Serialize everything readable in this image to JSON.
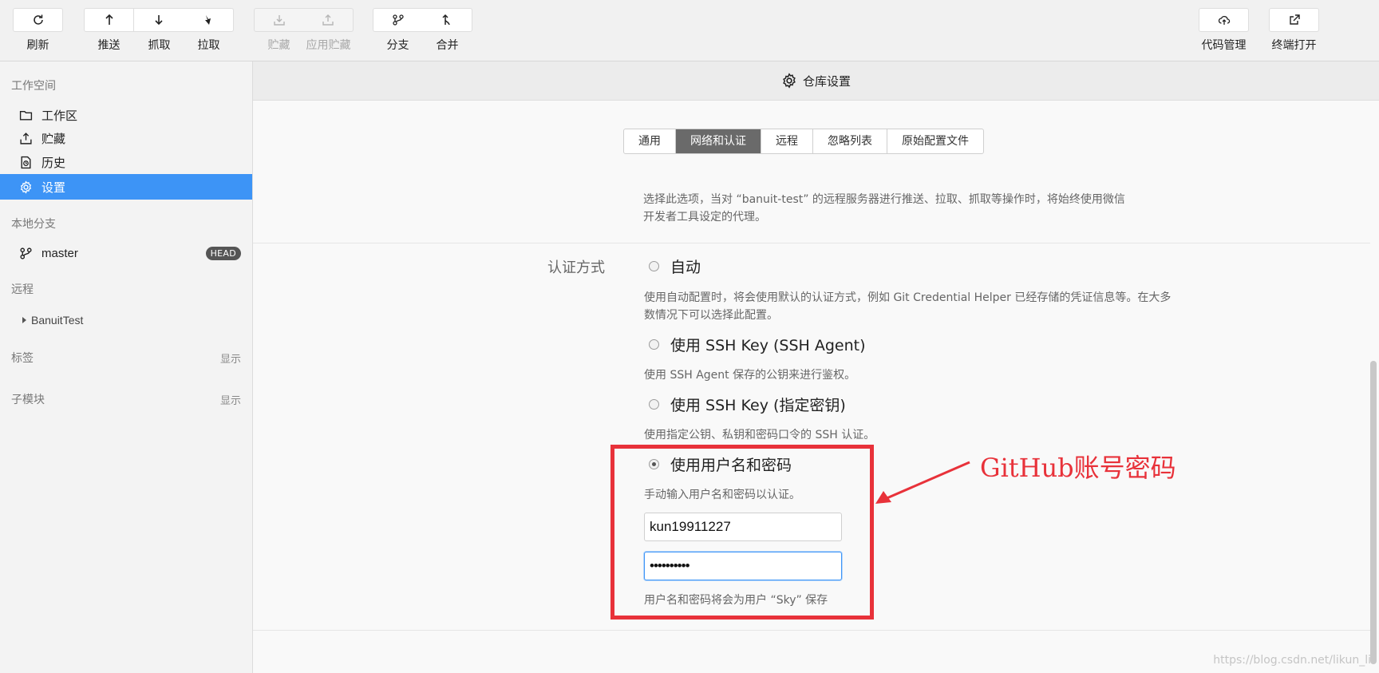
{
  "toolbar": {
    "refresh": "刷新",
    "push": "推送",
    "fetch": "抓取",
    "pull": "拉取",
    "stash": "贮藏",
    "apply_stash": "应用贮藏",
    "branch": "分支",
    "merge": "合并",
    "code_manage": "代码管理",
    "terminal_open": "终端打开"
  },
  "sidebar": {
    "workspace_title": "工作空间",
    "items": [
      "工作区",
      "贮藏",
      "历史",
      "设置"
    ],
    "local_branches_title": "本地分支",
    "branch_name": "master",
    "head_badge": "HEAD",
    "remote_title": "远程",
    "remote_name": "BanuitTest",
    "tags_title": "标签",
    "tags_show": "显示",
    "submodule_title": "子模块",
    "submodule_show": "显示"
  },
  "main": {
    "header_title": "仓库设置",
    "tabs": [
      "通用",
      "网络和认证",
      "远程",
      "忽略列表",
      "原始配置文件"
    ],
    "active_tab": "网络和认证",
    "proxy_desc_1": "选择此选项，当对 “banuit-test” 的远程服务器进行推送、拉取、抓取等操作时，将始终使用微信",
    "proxy_desc_2": "开发者工具设定的代理。",
    "auth_label": "认证方式",
    "options": [
      {
        "label": "自动",
        "desc1": "使用自动配置时，将会使用默认的认证方式，例如 Git Credential Helper 已经存储的凭证信息等。在大多",
        "desc2": "数情况下可以选择此配置。"
      },
      {
        "label": "使用 SSH Key (SSH Agent)",
        "desc1": "使用 SSH Agent 保存的公钥来进行鉴权。"
      },
      {
        "label": "使用 SSH Key (指定密钥)",
        "desc1": "使用指定公钥、私钥和密码口令的 SSH 认证。"
      },
      {
        "label": "使用用户名和密码",
        "desc1": "手动输入用户名和密码以认证。"
      }
    ],
    "username_value": "kun19911227",
    "password_value": "••••••••••",
    "save_note": "用户名和密码将会为用户 “Sky” 保存"
  },
  "annotation_text": "GitHub账号密码",
  "watermark": "https://blog.csdn.net/likun_li",
  "colors": {
    "accent": "#3d94f6",
    "annotation": "#e8323a"
  }
}
